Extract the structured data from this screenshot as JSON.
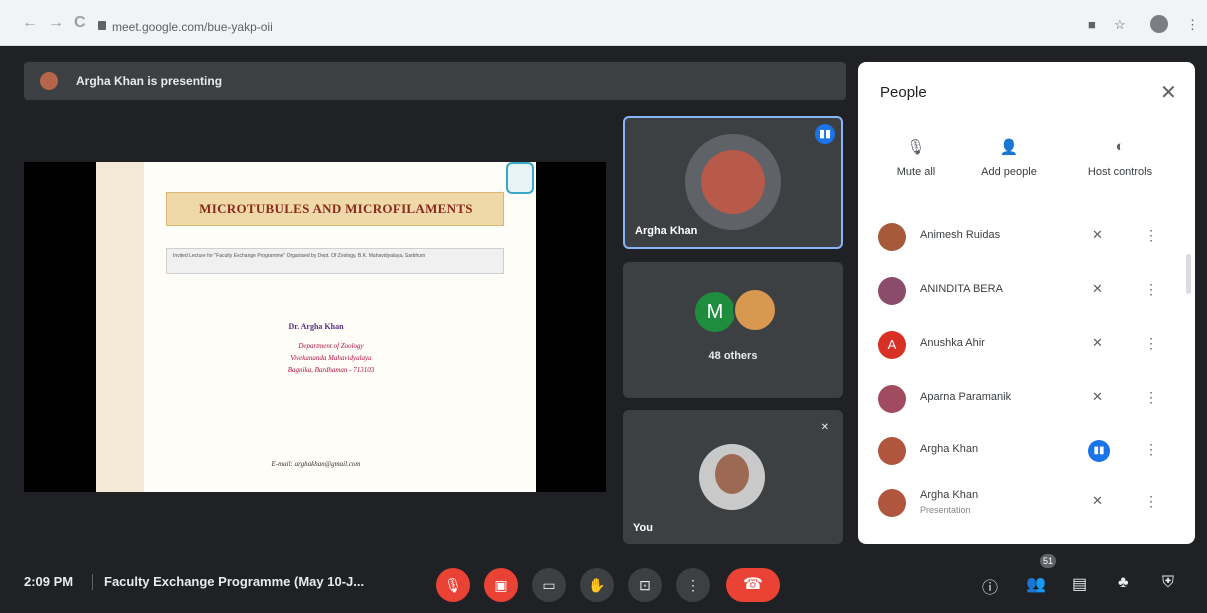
{
  "browser": {
    "url": "meet.google.com/bue-yakp-oii",
    "nav_back": "←",
    "nav_forward": "→",
    "nav_reload": "C"
  },
  "presenting": {
    "text": "Argha Khan is presenting"
  },
  "slide": {
    "title": "MICROTUBULES AND MICROFILAMENTS",
    "subtitle": "Invited Lecture for \"Faculty Exchange Programme\" Organised by Dept. Of Zoology, B.K. Mahavidyalaya, Sarbhum",
    "author": "Dr. Argha Khan",
    "dept_lines": [
      "Department of Zoology",
      "Vivekananda Mahavidyalaya",
      "Bagnika, Bardhaman - 713103"
    ],
    "email": "E-mail: arghakhan@gmail.com"
  },
  "tiles": {
    "speaker_name": "Argha Khan",
    "others_initial": "M",
    "others_label": "48 others",
    "you_label": "You"
  },
  "panel": {
    "title": "People",
    "close": "✕",
    "actions": [
      {
        "label": "Mute all",
        "icon": "mic-off-icon"
      },
      {
        "label": "Add people",
        "icon": "add-person-icon"
      },
      {
        "label": "Host controls",
        "icon": "toggle-icon"
      }
    ],
    "participants": [
      {
        "name": "Animesh Ruidas",
        "sub": "",
        "avatar_color": "#a65a3a",
        "initial": "",
        "mic": "muted"
      },
      {
        "name": "ANINDITA BERA",
        "sub": "",
        "avatar_color": "#8a4c6a",
        "initial": "",
        "mic": "muted"
      },
      {
        "name": "Anushka Ahir",
        "sub": "",
        "avatar_color": "#d93025",
        "initial": "A",
        "mic": "muted"
      },
      {
        "name": "Aparna Paramanik",
        "sub": "",
        "avatar_color": "#a04b5f",
        "initial": "",
        "mic": "muted"
      },
      {
        "name": "Argha Khan",
        "sub": "",
        "avatar_color": "#b0553e",
        "initial": "",
        "mic": "speaking"
      },
      {
        "name": "Argha Khan",
        "sub": "Presentation",
        "avatar_color": "#b0553e",
        "initial": "",
        "mic": "muted"
      }
    ]
  },
  "bottom": {
    "time": "2:09 PM",
    "meeting_title": "Faculty Exchange Programme (May 10-J...",
    "participants_count": "51"
  },
  "colors": {
    "background": "#202124",
    "tile": "#3c4043",
    "accent_blue": "#1a73e8",
    "red": "#ea4335"
  }
}
